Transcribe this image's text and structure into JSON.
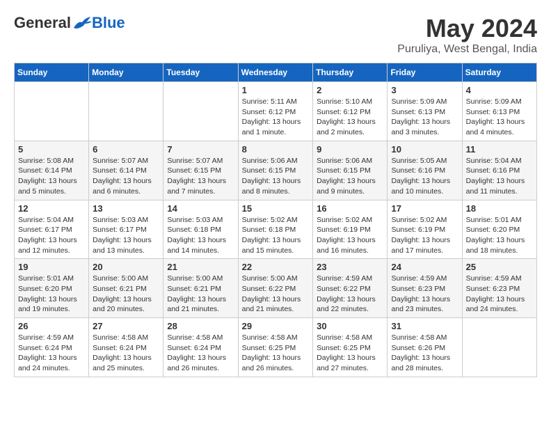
{
  "header": {
    "logo_general": "General",
    "logo_blue": "Blue",
    "title": "May 2024",
    "subtitle": "Puruliya, West Bengal, India"
  },
  "weekdays": [
    "Sunday",
    "Monday",
    "Tuesday",
    "Wednesday",
    "Thursday",
    "Friday",
    "Saturday"
  ],
  "weeks": [
    [
      {
        "day": "",
        "info": ""
      },
      {
        "day": "",
        "info": ""
      },
      {
        "day": "",
        "info": ""
      },
      {
        "day": "1",
        "info": "Sunrise: 5:11 AM\nSunset: 6:12 PM\nDaylight: 13 hours\nand 1 minute."
      },
      {
        "day": "2",
        "info": "Sunrise: 5:10 AM\nSunset: 6:12 PM\nDaylight: 13 hours\nand 2 minutes."
      },
      {
        "day": "3",
        "info": "Sunrise: 5:09 AM\nSunset: 6:13 PM\nDaylight: 13 hours\nand 3 minutes."
      },
      {
        "day": "4",
        "info": "Sunrise: 5:09 AM\nSunset: 6:13 PM\nDaylight: 13 hours\nand 4 minutes."
      }
    ],
    [
      {
        "day": "5",
        "info": "Sunrise: 5:08 AM\nSunset: 6:14 PM\nDaylight: 13 hours\nand 5 minutes."
      },
      {
        "day": "6",
        "info": "Sunrise: 5:07 AM\nSunset: 6:14 PM\nDaylight: 13 hours\nand 6 minutes."
      },
      {
        "day": "7",
        "info": "Sunrise: 5:07 AM\nSunset: 6:15 PM\nDaylight: 13 hours\nand 7 minutes."
      },
      {
        "day": "8",
        "info": "Sunrise: 5:06 AM\nSunset: 6:15 PM\nDaylight: 13 hours\nand 8 minutes."
      },
      {
        "day": "9",
        "info": "Sunrise: 5:06 AM\nSunset: 6:15 PM\nDaylight: 13 hours\nand 9 minutes."
      },
      {
        "day": "10",
        "info": "Sunrise: 5:05 AM\nSunset: 6:16 PM\nDaylight: 13 hours\nand 10 minutes."
      },
      {
        "day": "11",
        "info": "Sunrise: 5:04 AM\nSunset: 6:16 PM\nDaylight: 13 hours\nand 11 minutes."
      }
    ],
    [
      {
        "day": "12",
        "info": "Sunrise: 5:04 AM\nSunset: 6:17 PM\nDaylight: 13 hours\nand 12 minutes."
      },
      {
        "day": "13",
        "info": "Sunrise: 5:03 AM\nSunset: 6:17 PM\nDaylight: 13 hours\nand 13 minutes."
      },
      {
        "day": "14",
        "info": "Sunrise: 5:03 AM\nSunset: 6:18 PM\nDaylight: 13 hours\nand 14 minutes."
      },
      {
        "day": "15",
        "info": "Sunrise: 5:02 AM\nSunset: 6:18 PM\nDaylight: 13 hours\nand 15 minutes."
      },
      {
        "day": "16",
        "info": "Sunrise: 5:02 AM\nSunset: 6:19 PM\nDaylight: 13 hours\nand 16 minutes."
      },
      {
        "day": "17",
        "info": "Sunrise: 5:02 AM\nSunset: 6:19 PM\nDaylight: 13 hours\nand 17 minutes."
      },
      {
        "day": "18",
        "info": "Sunrise: 5:01 AM\nSunset: 6:20 PM\nDaylight: 13 hours\nand 18 minutes."
      }
    ],
    [
      {
        "day": "19",
        "info": "Sunrise: 5:01 AM\nSunset: 6:20 PM\nDaylight: 13 hours\nand 19 minutes."
      },
      {
        "day": "20",
        "info": "Sunrise: 5:00 AM\nSunset: 6:21 PM\nDaylight: 13 hours\nand 20 minutes."
      },
      {
        "day": "21",
        "info": "Sunrise: 5:00 AM\nSunset: 6:21 PM\nDaylight: 13 hours\nand 21 minutes."
      },
      {
        "day": "22",
        "info": "Sunrise: 5:00 AM\nSunset: 6:22 PM\nDaylight: 13 hours\nand 21 minutes."
      },
      {
        "day": "23",
        "info": "Sunrise: 4:59 AM\nSunset: 6:22 PM\nDaylight: 13 hours\nand 22 minutes."
      },
      {
        "day": "24",
        "info": "Sunrise: 4:59 AM\nSunset: 6:23 PM\nDaylight: 13 hours\nand 23 minutes."
      },
      {
        "day": "25",
        "info": "Sunrise: 4:59 AM\nSunset: 6:23 PM\nDaylight: 13 hours\nand 24 minutes."
      }
    ],
    [
      {
        "day": "26",
        "info": "Sunrise: 4:59 AM\nSunset: 6:24 PM\nDaylight: 13 hours\nand 24 minutes."
      },
      {
        "day": "27",
        "info": "Sunrise: 4:58 AM\nSunset: 6:24 PM\nDaylight: 13 hours\nand 25 minutes."
      },
      {
        "day": "28",
        "info": "Sunrise: 4:58 AM\nSunset: 6:24 PM\nDaylight: 13 hours\nand 26 minutes."
      },
      {
        "day": "29",
        "info": "Sunrise: 4:58 AM\nSunset: 6:25 PM\nDaylight: 13 hours\nand 26 minutes."
      },
      {
        "day": "30",
        "info": "Sunrise: 4:58 AM\nSunset: 6:25 PM\nDaylight: 13 hours\nand 27 minutes."
      },
      {
        "day": "31",
        "info": "Sunrise: 4:58 AM\nSunset: 6:26 PM\nDaylight: 13 hours\nand 28 minutes."
      },
      {
        "day": "",
        "info": ""
      }
    ]
  ]
}
